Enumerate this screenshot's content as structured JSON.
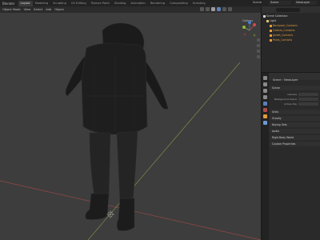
{
  "topbar": {
    "menus": [
      "Blender"
    ],
    "tabs": [
      "Layout",
      "Modeling",
      "Sculpting",
      "UV Editing",
      "Texture Paint",
      "Shading",
      "Animation",
      "Rendering",
      "Compositing",
      "Scripting"
    ],
    "active_tab": "Layout",
    "scene_label": "Scene",
    "scene_value": "Scene",
    "view_layer_value": "ViewLayer"
  },
  "viewport": {
    "header_items": [
      "Object Mode",
      "View",
      "Select",
      "Add",
      "Object"
    ],
    "options_label": "Options"
  },
  "outliner": {
    "rows": [
      {
        "label": "Scene Collection",
        "icon": "collection-icon",
        "color": "#cfcfcf",
        "indent": 0
      },
      {
        "label": "Light",
        "icon": "light-icon",
        "color": "#cfcfcf",
        "indent": 1
      },
      {
        "label": "Backpack_Contains",
        "icon": "mesh-icon",
        "color": "#e39a3c",
        "indent": 2
      },
      {
        "label": "Clothes_Contains",
        "icon": "mesh-icon",
        "color": "#e39a3c",
        "indent": 2
      },
      {
        "label": "Jacket_Contains",
        "icon": "mesh-icon",
        "color": "#e39a3c",
        "indent": 2
      },
      {
        "label": "Pants_Contains",
        "icon": "mesh-icon",
        "color": "#e39a3c",
        "indent": 2
      }
    ]
  },
  "properties": {
    "breadcrumb_scene": "Scene",
    "breadcrumb_layer": "ViewLayer",
    "scene_panel": "Scene",
    "fields": [
      "Camera",
      "Background Scene",
      "Active Clip"
    ],
    "panels": [
      "Units",
      "Gravity",
      "Keying Sets",
      "Audio",
      "Rigid Body World",
      "Custom Properties"
    ]
  },
  "colors": {
    "viewport_bg": "#3d3d3d",
    "x_axis": "#b04a4a",
    "y_axis": "#8aa14a",
    "accent": "#5c80b8"
  }
}
